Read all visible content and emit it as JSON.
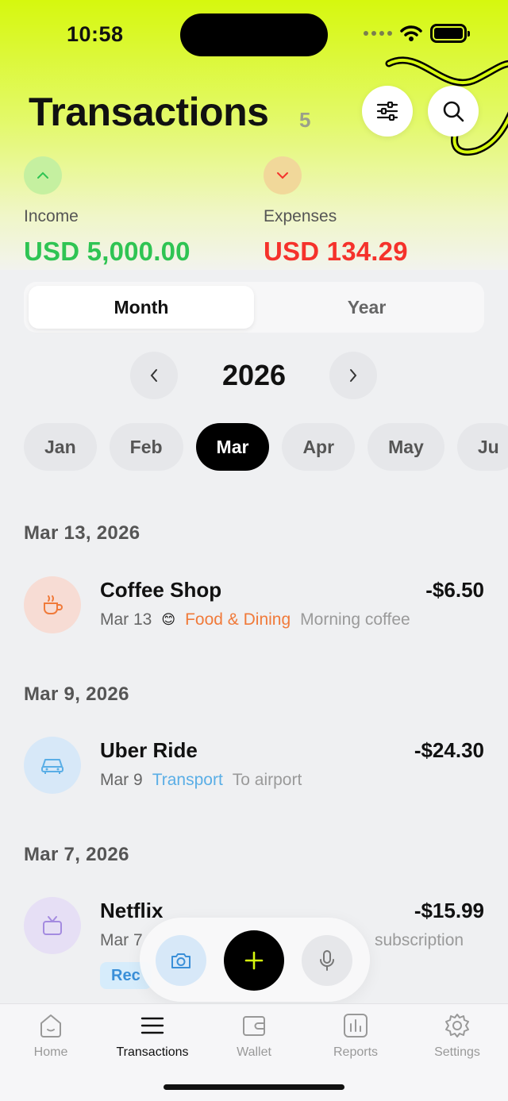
{
  "status": {
    "time": "10:58"
  },
  "header": {
    "title": "Transactions",
    "count": "5"
  },
  "summary": {
    "income": {
      "label": "Income",
      "value": "USD 5,000.00",
      "color": "#2fc453"
    },
    "expenses": {
      "label": "Expenses",
      "value": "USD 134.29",
      "color": "#f5322b"
    }
  },
  "segment": {
    "month": "Month",
    "year": "Year",
    "selected": "Month"
  },
  "year": "2026",
  "months": [
    "Jan",
    "Feb",
    "Mar",
    "Apr",
    "May",
    "Ju"
  ],
  "selected_month": "Mar",
  "groups": [
    {
      "date": "Mar 13, 2026",
      "tx": {
        "name": "Coffee Shop",
        "amount": "-$6.50",
        "date": "Mar 13",
        "emoji": "😊",
        "category": "Food & Dining",
        "category_color": "#f07a3a",
        "note": "Morning coffee",
        "icon": "coffee-icon"
      }
    },
    {
      "date": "Mar 9, 2026",
      "tx": {
        "name": "Uber Ride",
        "amount": "-$24.30",
        "date": "Mar 9",
        "category": "Transport",
        "category_color": "#5aaee6",
        "note": "To airport",
        "icon": "car-icon"
      }
    },
    {
      "date": "Mar 7, 2026",
      "tx": {
        "name": "Netflix",
        "amount": "-$15.99",
        "date": "Mar 7",
        "note": "subscription",
        "tag": "Rec",
        "icon": "tv-icon"
      }
    }
  ],
  "tabbar": [
    {
      "label": "Home",
      "icon": "home-icon"
    },
    {
      "label": "Transactions",
      "icon": "list-icon",
      "active": true
    },
    {
      "label": "Wallet",
      "icon": "wallet-icon"
    },
    {
      "label": "Reports",
      "icon": "chart-icon"
    },
    {
      "label": "Settings",
      "icon": "gear-icon"
    }
  ]
}
